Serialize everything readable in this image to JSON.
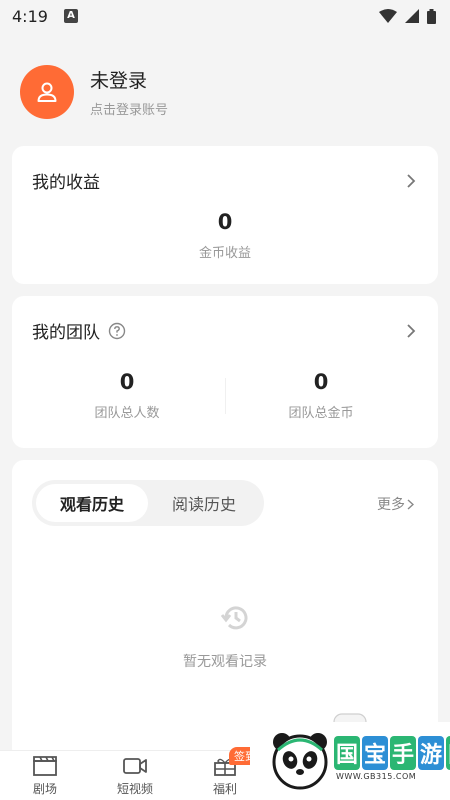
{
  "status_bar": {
    "time": "4:19",
    "notif_letter": "A"
  },
  "profile": {
    "name": "未登录",
    "subtitle": "点击登录账号"
  },
  "earnings": {
    "title": "我的收益",
    "value": "0",
    "label": "金币收益"
  },
  "team": {
    "title": "我的团队",
    "members_value": "0",
    "members_label": "团队总人数",
    "coins_value": "0",
    "coins_label": "团队总金币"
  },
  "history": {
    "tabs": [
      "观看历史",
      "阅读历史"
    ],
    "active_tab": 0,
    "more_label": "更多",
    "empty_text": "暂无观看记录"
  },
  "tabbar": {
    "items": [
      {
        "label": "剧场",
        "icon": "clapperboard-icon"
      },
      {
        "label": "短视频",
        "icon": "video-camera-icon"
      },
      {
        "label": "福利",
        "icon": "gift-icon",
        "badge": "签到"
      }
    ]
  },
  "watermark": {
    "chars": [
      "国",
      "宝",
      "手",
      "游",
      "网"
    ],
    "url": "WWW.GB315.COM"
  },
  "colors": {
    "accent": "#ff6b35",
    "background": "#f4f4f4",
    "card": "#ffffff"
  }
}
